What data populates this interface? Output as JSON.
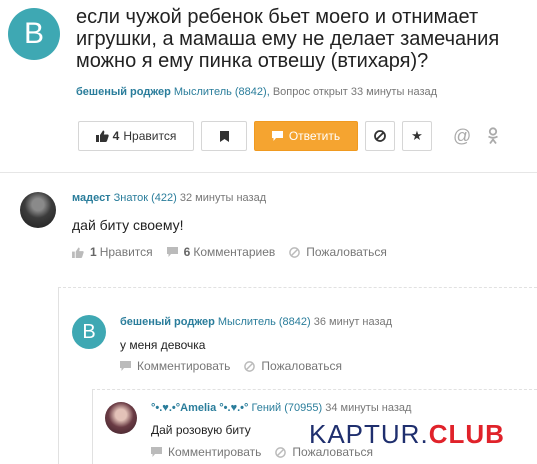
{
  "question": {
    "avatar_letter": "B",
    "title": "если чужой ребенок бьет моего и отнимает игрушки, а мамаша ему не делает замечания можно я ему пинка отвешу (втихаря)?",
    "author": "бешеный роджер",
    "rank": "Мыслитель (8842),",
    "status": "Вопрос открыт 33 минуты назад"
  },
  "actions": {
    "like_count": "4",
    "like_label": "Нравится",
    "answer_label": "Ответить",
    "icons": {
      "like": "thumbs-up-icon",
      "bookmark": "bookmark-icon",
      "answer": "comment-icon",
      "block": "block-icon",
      "favorite": "star-icon",
      "email": "at-sign-icon",
      "odnoklassniki": "odnoklassniki-icon"
    }
  },
  "comments": [
    {
      "author": "мадест",
      "rank": "Знаток (422)",
      "time": "32 минуты назад",
      "text": "дай биту своему!",
      "likes": "1",
      "like_label": "Нравится",
      "comments_count": "6",
      "comments_label": "Комментариев",
      "report_label": "Пожаловаться"
    },
    {
      "avatar_letter": "B",
      "author": "бешеный роджер",
      "rank": "Мыслитель (8842)",
      "time": "36 минут назад",
      "text": "у меня девочка",
      "comment_label": "Комментировать",
      "report_label": "Пожаловаться"
    },
    {
      "author": "°•.♥.•°Amelia °•.♥.•°",
      "rank": "Гений (70955)",
      "time": "34 минуты назад",
      "text": "Дай розовую биту",
      "comment_label": "Комментировать",
      "report_label": "Пожаловаться"
    }
  ],
  "watermark": {
    "part1": "KAPTUR.",
    "part2": "CLUB"
  },
  "colors": {
    "accent": "#3ea8b3",
    "link": "#2a7d9b",
    "answer_button": "#f5a430"
  }
}
